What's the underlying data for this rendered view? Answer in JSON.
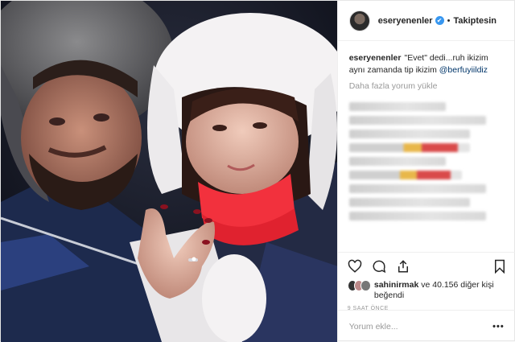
{
  "header": {
    "username": "eseryenenler",
    "verified_glyph": "✔",
    "separator": "•",
    "follow_label": "Takiptesin"
  },
  "caption": {
    "username": "eseryenenler",
    "text": "\"Evet\" dedi...ruh ikizim aynı zamanda tip ikizim",
    "mention": "@berfuyiildiz"
  },
  "more_comments_label": "Daha fazla yorum yükle",
  "likes": {
    "liker": "sahinirmak",
    "rest": " ve 40.156 diğer kişi beğendi",
    "count": 40157
  },
  "timestamp": "9 SAAT ÖNCE",
  "comment_box": {
    "placeholder": "Yorum ekle...",
    "more_glyph": "•••"
  },
  "icons": [
    "heart-icon",
    "comment-icon",
    "share-icon",
    "bookmark-icon"
  ]
}
